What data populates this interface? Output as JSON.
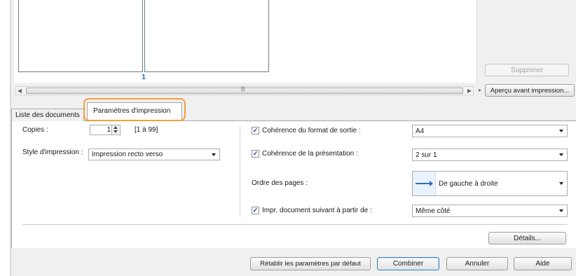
{
  "preview": {
    "page_number": "1",
    "faint_indicator": "1"
  },
  "right_buttons": {
    "delete": "Supprimer",
    "preview": "Aperçu avant impression..."
  },
  "tabs": [
    {
      "label": "Liste des documents"
    },
    {
      "label": "Paramètres d'impression"
    }
  ],
  "left_settings": {
    "copies_label": "Copies :",
    "copies_value": "1",
    "copies_range": "[1 à 99]",
    "style_label": "Style d'impression :",
    "style_value": "Impression recto verso"
  },
  "right_settings": {
    "format_check_label": "Cohérence du format de sortie :",
    "format_value": "A4",
    "layout_check_label": "Cohérence de la présentation :",
    "layout_value": "2 sur 1",
    "page_order_label": "Ordre des pages :",
    "page_order_value": "De gauche à droite",
    "next_doc_label": "Impr. document suivant à partir de :",
    "next_doc_value": "Même côté"
  },
  "buttons": {
    "details": "Détails...",
    "restore": "Rétablir les paramètres par défaut",
    "combine": "Combiner",
    "cancel": "Annuler",
    "help": "Aide"
  },
  "icons": {
    "spin_up": "spin-up-icon",
    "spin_down": "spin-down-icon",
    "page_order": "left-to-right-order-icon"
  },
  "colors": {
    "tab_highlight": "#f2a03a",
    "page_number": "#1566c0"
  }
}
